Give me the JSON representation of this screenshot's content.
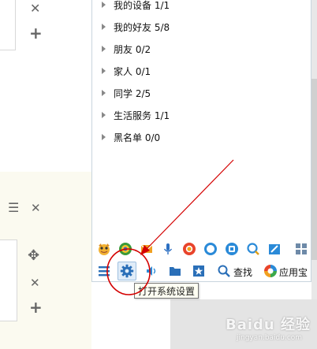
{
  "groups": [
    {
      "label": "我的设备 1/1"
    },
    {
      "label": "我的好友 5/8"
    },
    {
      "label": "朋友 0/2"
    },
    {
      "label": "家人 0/1"
    },
    {
      "label": "同学 2/5"
    },
    {
      "label": "生活服务 1/1"
    },
    {
      "label": "黑名单 0/0"
    }
  ],
  "toolbar": {
    "search_label": "查找",
    "app_store_label": "应用宝"
  },
  "tooltip": {
    "text": "打开系统设置"
  },
  "watermark": {
    "brand": "Baidu 经验",
    "url": "jingyan.baidu.com"
  },
  "colors": {
    "annotation_red": "#d40000",
    "qq_blue": "#2a8ad8"
  },
  "icons": {
    "left_page": [
      "close-icon",
      "plus-icon",
      "list-icon",
      "move-icon"
    ],
    "toolbar_row1": [
      "pet-icon",
      "qzone-icon",
      "mail-icon",
      "mic-icon",
      "browser-icon",
      "ring-icon",
      "tencent-icon",
      "search-app-icon",
      "edit-icon",
      "grid-icon"
    ],
    "toolbar_row2": [
      "menu-icon",
      "gear-icon",
      "volume-icon",
      "folder-icon",
      "star-icon",
      "search-icon",
      "app-store-icon"
    ]
  }
}
